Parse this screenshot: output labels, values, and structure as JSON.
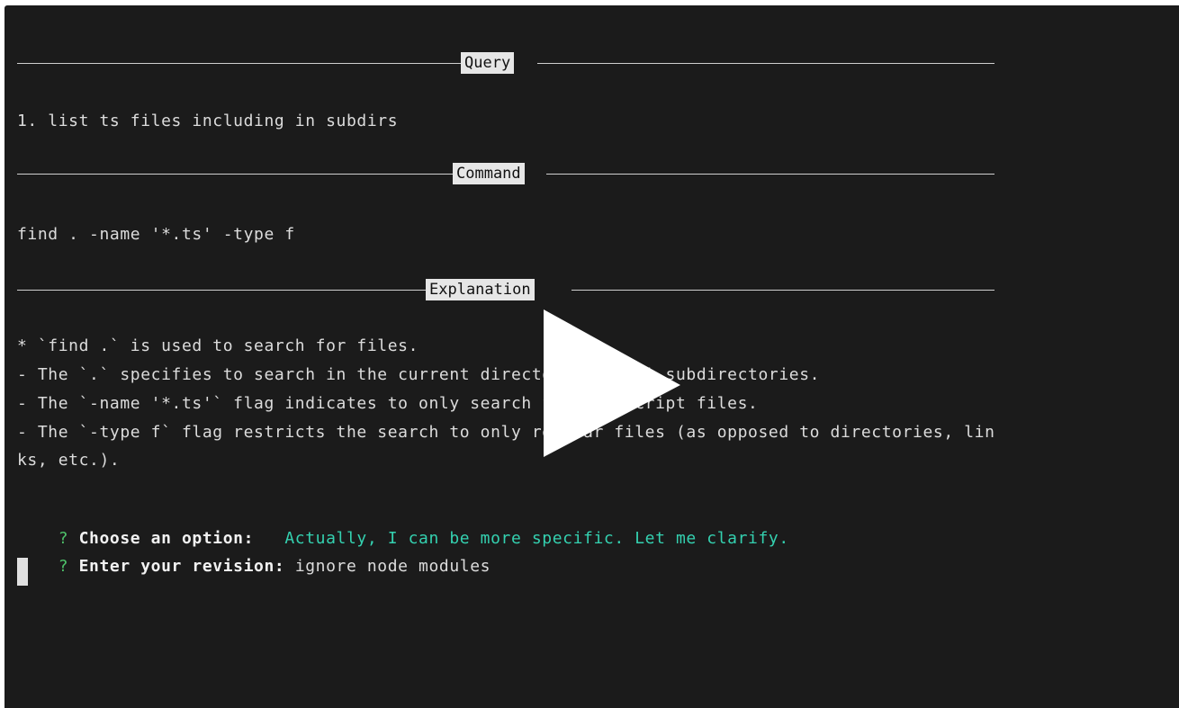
{
  "sections": {
    "query_title": "Query",
    "command_title": "Command",
    "explanation_title": "Explanation"
  },
  "query": {
    "item": "1. list ts files including in subdirs"
  },
  "command": {
    "text": "find . -name '*.ts' -type f"
  },
  "explanation": {
    "lines": [
      "* `find .` is used to search for files.",
      "- The `.` specifies to search in the current directory and all subdirectories.",
      "- The `-name '*.ts'` flag indicates to only search for typescript files.",
      "- The `-type f` flag restricts the search to only regular files (as opposed to directories, lin",
      "ks, etc.)."
    ]
  },
  "prompts": {
    "choose": {
      "marker": "?",
      "label": "Choose an option:",
      "value": "Actually, I can be more specific. Let me clarify."
    },
    "revision": {
      "marker": "?",
      "label": "Enter your revision:",
      "value": "ignore node modules"
    }
  },
  "overlay": {
    "icon": "play-icon"
  },
  "colors": {
    "background": "#1b1b1b",
    "text": "#dcdcdc",
    "prompt_marker": "#4ec26a",
    "answer": "#34d1b0",
    "section_label_bg": "#e6e6e6"
  }
}
